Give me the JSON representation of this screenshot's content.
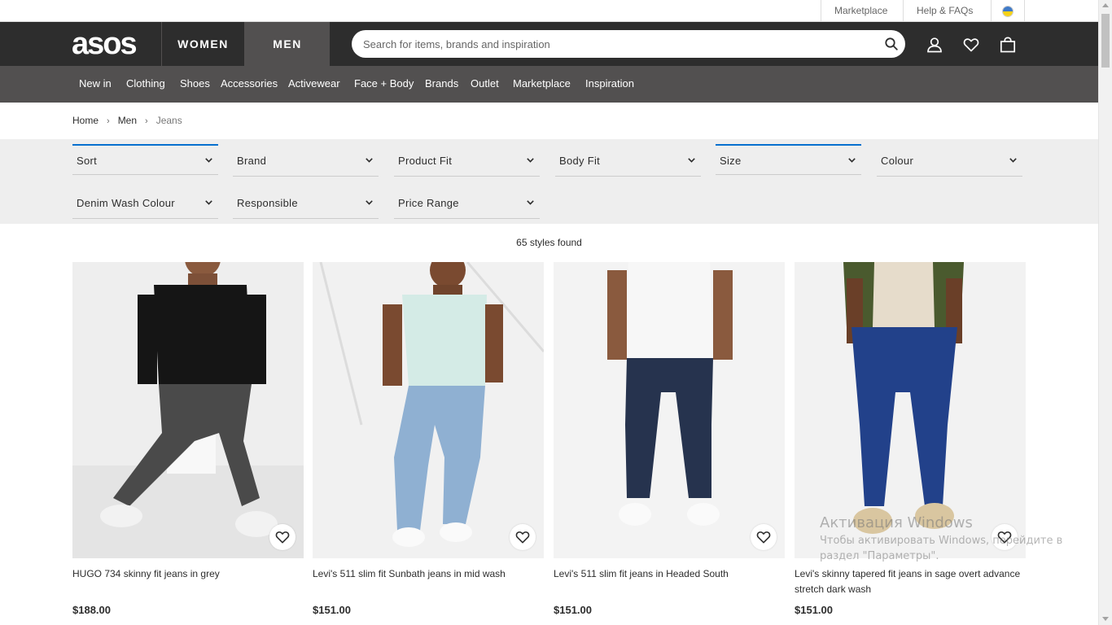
{
  "colors": {
    "header_bg": "#2d2d2d",
    "men_tab_bg": "#525050",
    "nav_bg": "#525050",
    "filter_bg": "#eeeeee",
    "active_filter_accent": "#0770cf",
    "flag_blue": "#3f7ac9",
    "flag_yellow": "#f7d218"
  },
  "utility_bar": {
    "marketplace": "Marketplace",
    "help": "Help & FAQs",
    "flag": "ukraine-flag-icon"
  },
  "header": {
    "logo": "asos",
    "tabs": [
      {
        "label": "WOMEN",
        "selected": false
      },
      {
        "label": "MEN",
        "selected": true
      }
    ],
    "search": {
      "placeholder": "Search for items, brands and inspiration",
      "value": ""
    },
    "icons": [
      "search-icon",
      "account-icon",
      "wishlist-heart-icon",
      "shopping-bag-icon"
    ]
  },
  "nav": {
    "items": [
      "New in",
      "Clothing",
      "Shoes",
      "Accessories",
      "Activewear",
      "Face + Body",
      "Brands",
      "Outlet",
      "Marketplace",
      "Inspiration"
    ]
  },
  "breadcrumb": {
    "items": [
      "Home",
      "Men",
      "Jeans"
    ],
    "separator": "›"
  },
  "filters": [
    {
      "label": "Sort",
      "active": true
    },
    {
      "label": "Brand",
      "active": false
    },
    {
      "label": "Product Fit",
      "active": false
    },
    {
      "label": "Body Fit",
      "active": false
    },
    {
      "label": "Size",
      "active": true
    },
    {
      "label": "Colour",
      "active": false
    },
    {
      "label": "Denim Wash Colour",
      "active": false
    },
    {
      "label": "Responsible",
      "active": false
    },
    {
      "label": "Price Range",
      "active": false
    }
  ],
  "results": {
    "count_text": "65 styles found"
  },
  "products": [
    {
      "name": "HUGO 734 skinny fit jeans in grey",
      "price": "$188.00",
      "jeans_color": "#4a4a4a",
      "top_color": "#151515"
    },
    {
      "name": "Levi's 511 slim fit Sunbath jeans in mid wash",
      "price": "$151.00",
      "jeans_color": "#8fb0d2",
      "top_color": "#d4ebe6"
    },
    {
      "name": "Levi's 511 slim fit jeans in Headed South",
      "price": "$151.00",
      "jeans_color": "#26334e",
      "top_color": "#f7f7f7"
    },
    {
      "name": "Levi's skinny tapered fit jeans in sage overt advance stretch dark wash",
      "price": "$151.00",
      "jeans_color": "#22418a",
      "top_color": "#4a5a2e"
    }
  ],
  "watermark": {
    "title": "Активация Windows",
    "line1": "Чтобы активировать Windows, перейдите в",
    "line2": "раздел \"Параметры\"."
  }
}
